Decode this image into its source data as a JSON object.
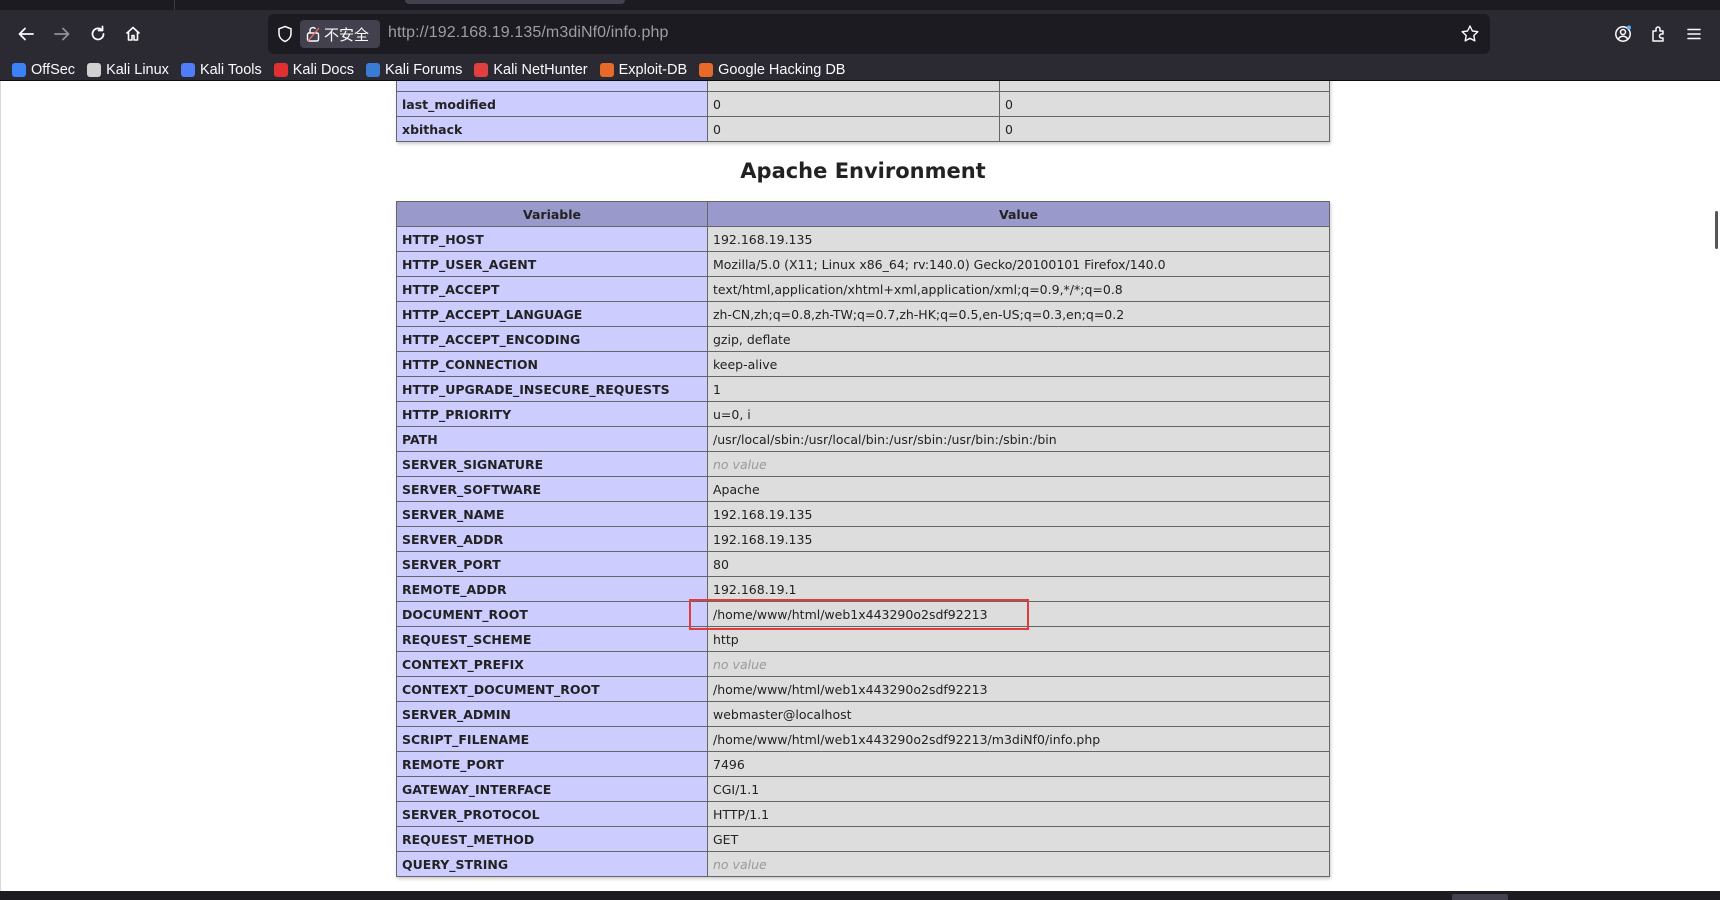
{
  "browser": {
    "insecure_label": "不安全",
    "url_host": "http://192.168.19.135",
    "url_path": "/m3diNf0/info.php",
    "bookmarks": [
      {
        "label": "OffSec",
        "icon": "offsec-icon",
        "color": "#3b82f6"
      },
      {
        "label": "Kali Linux",
        "icon": "kali-dragon-icon",
        "color": "#d0d0d0"
      },
      {
        "label": "Kali Tools",
        "icon": "kali-tools-icon",
        "color": "#4f7cf7"
      },
      {
        "label": "Kali Docs",
        "icon": "kali-docs-icon",
        "color": "#e03030"
      },
      {
        "label": "Kali Forums",
        "icon": "kali-forums-icon",
        "color": "#3a7bd5"
      },
      {
        "label": "Kali NetHunter",
        "icon": "nethunter-icon",
        "color": "#e04040"
      },
      {
        "label": "Exploit-DB",
        "icon": "exploit-db-icon",
        "color": "#e86a2a"
      },
      {
        "label": "Google Hacking DB",
        "icon": "ghdb-icon",
        "color": "#e86a2a"
      }
    ]
  },
  "top_table": {
    "rows": [
      {
        "name": "last_modified",
        "local": "0",
        "master": "0"
      },
      {
        "name": "xbithack",
        "local": "0",
        "master": "0"
      }
    ]
  },
  "env_section": {
    "title": "Apache Environment",
    "header_variable": "Variable",
    "header_value": "Value",
    "rows": [
      {
        "name": "HTTP_HOST",
        "value": "192.168.19.135"
      },
      {
        "name": "HTTP_USER_AGENT",
        "value": "Mozilla/5.0 (X11; Linux x86_64; rv:140.0) Gecko/20100101 Firefox/140.0"
      },
      {
        "name": "HTTP_ACCEPT",
        "value": "text/html,application/xhtml+xml,application/xml;q=0.9,*/*;q=0.8"
      },
      {
        "name": "HTTP_ACCEPT_LANGUAGE",
        "value": "zh-CN,zh;q=0.8,zh-TW;q=0.7,zh-HK;q=0.5,en-US;q=0.3,en;q=0.2"
      },
      {
        "name": "HTTP_ACCEPT_ENCODING",
        "value": "gzip, deflate"
      },
      {
        "name": "HTTP_CONNECTION",
        "value": "keep-alive"
      },
      {
        "name": "HTTP_UPGRADE_INSECURE_REQUESTS",
        "value": "1"
      },
      {
        "name": "HTTP_PRIORITY",
        "value": "u=0, i"
      },
      {
        "name": "PATH",
        "value": "/usr/local/sbin:/usr/local/bin:/usr/sbin:/usr/bin:/sbin:/bin"
      },
      {
        "name": "SERVER_SIGNATURE",
        "value": "no value",
        "novalue": true
      },
      {
        "name": "SERVER_SOFTWARE",
        "value": "Apache"
      },
      {
        "name": "SERVER_NAME",
        "value": "192.168.19.135"
      },
      {
        "name": "SERVER_ADDR",
        "value": "192.168.19.135"
      },
      {
        "name": "SERVER_PORT",
        "value": "80"
      },
      {
        "name": "REMOTE_ADDR",
        "value": "192.168.19.1"
      },
      {
        "name": "DOCUMENT_ROOT",
        "value": "/home/www/html/web1x443290o2sdf92213",
        "highlighted": true
      },
      {
        "name": "REQUEST_SCHEME",
        "value": "http"
      },
      {
        "name": "CONTEXT_PREFIX",
        "value": "no value",
        "novalue": true
      },
      {
        "name": "CONTEXT_DOCUMENT_ROOT",
        "value": "/home/www/html/web1x443290o2sdf92213"
      },
      {
        "name": "SERVER_ADMIN",
        "value": "webmaster@localhost"
      },
      {
        "name": "SCRIPT_FILENAME",
        "value": "/home/www/html/web1x443290o2sdf92213/m3diNf0/info.php"
      },
      {
        "name": "REMOTE_PORT",
        "value": "7496"
      },
      {
        "name": "GATEWAY_INTERFACE",
        "value": "CGI/1.1"
      },
      {
        "name": "SERVER_PROTOCOL",
        "value": "HTTP/1.1"
      },
      {
        "name": "REQUEST_METHOD",
        "value": "GET"
      },
      {
        "name": "QUERY_STRING",
        "value": "no value",
        "novalue": true
      }
    ]
  },
  "colors": {
    "highlight_box": "#e03c3c",
    "name_cell_bg": "#ccccff",
    "value_cell_bg": "#dddddd",
    "header_bg": "#9999cc"
  }
}
